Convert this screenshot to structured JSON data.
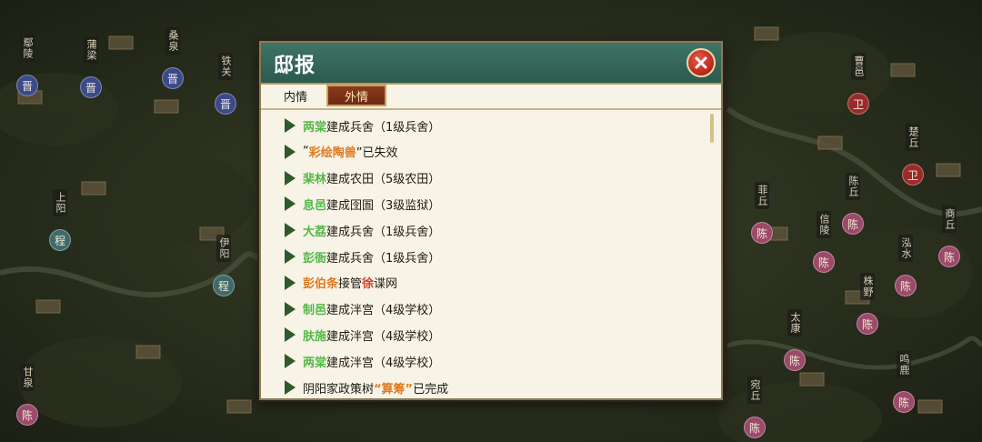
{
  "dialog": {
    "title": "邸报",
    "close_icon": "close-icon"
  },
  "tabs": [
    {
      "label": "内情",
      "active": false
    },
    {
      "label": "外情",
      "active": true
    }
  ],
  "colors": {
    "green": "#54b848",
    "orange": "#e07a22",
    "red": "#d9402a",
    "dark": "#1d1a14"
  },
  "news": [
    {
      "parts": [
        {
          "t": "两棠",
          "c": "green"
        },
        {
          "t": "建成兵舍（1级兵舍）",
          "c": "dark"
        }
      ]
    },
    {
      "parts": [
        {
          "t": "“",
          "c": "dark"
        },
        {
          "t": "彩绘陶兽",
          "c": "orange"
        },
        {
          "t": "”已失效",
          "c": "dark"
        }
      ]
    },
    {
      "parts": [
        {
          "t": "棐林",
          "c": "green"
        },
        {
          "t": "建成农田（5级农田）",
          "c": "dark"
        }
      ]
    },
    {
      "parts": [
        {
          "t": "息邑",
          "c": "green"
        },
        {
          "t": "建成囹圄（3级监狱）",
          "c": "dark"
        }
      ]
    },
    {
      "parts": [
        {
          "t": "大荔",
          "c": "green"
        },
        {
          "t": "建成兵舍（1级兵舍）",
          "c": "dark"
        }
      ]
    },
    {
      "parts": [
        {
          "t": "彭衙",
          "c": "green"
        },
        {
          "t": "建成兵舍（1级兵舍）",
          "c": "dark"
        }
      ]
    },
    {
      "parts": [
        {
          "t": "彭伯条",
          "c": "orange"
        },
        {
          "t": "接管",
          "c": "dark"
        },
        {
          "t": "徐",
          "c": "red"
        },
        {
          "t": "谍网",
          "c": "dark"
        }
      ]
    },
    {
      "parts": [
        {
          "t": "制邑",
          "c": "green"
        },
        {
          "t": "建成泮宫（4级学校）",
          "c": "dark"
        }
      ]
    },
    {
      "parts": [
        {
          "t": "肤施",
          "c": "green"
        },
        {
          "t": "建成泮宫（4级学校）",
          "c": "dark"
        }
      ]
    },
    {
      "parts": [
        {
          "t": "两棠",
          "c": "green"
        },
        {
          "t": "建成泮宫（4级学校）",
          "c": "dark"
        }
      ]
    },
    {
      "parts": [
        {
          "t": "阴阳家政策树",
          "c": "dark"
        },
        {
          "t": "“算筹”",
          "c": "orange"
        },
        {
          "t": "已完成",
          "c": "dark"
        }
      ]
    }
  ],
  "map": {
    "labels": [
      {
        "text": "鄢陵",
        "seal": "晋",
        "sealColor": "#3b4a8a"
      },
      {
        "text": "蒲梁",
        "seal": "晋",
        "sealColor": "#3b4a8a"
      },
      {
        "text": "桑泉",
        "seal": "晋",
        "sealColor": "#3b4a8a"
      },
      {
        "text": "铁关",
        "seal": "晋",
        "sealColor": "#3b4a8a"
      },
      {
        "text": "曹邑",
        "seal": "卫",
        "sealColor": "#9a2b2b"
      },
      {
        "text": "楚丘",
        "seal": "卫",
        "sealColor": "#9a2b2b"
      },
      {
        "text": "菲丘",
        "seal": "陈",
        "sealColor": "#9b4a6a"
      },
      {
        "text": "陈丘",
        "seal": "陈",
        "sealColor": "#9b4a6a"
      },
      {
        "text": "信陵",
        "seal": "陈",
        "sealColor": "#9b4a6a"
      },
      {
        "text": "株野",
        "seal": "陈",
        "sealColor": "#9b4a6a"
      },
      {
        "text": "太康",
        "seal": "陈",
        "sealColor": "#9b4a6a"
      },
      {
        "text": "商丘",
        "seal": "陈",
        "sealColor": "#9b4a6a"
      },
      {
        "text": "泓水",
        "seal": "陈",
        "sealColor": "#9b4a6a"
      },
      {
        "text": "鸣鹿",
        "seal": "陈",
        "sealColor": "#9b4a6a"
      },
      {
        "text": "宛丘",
        "seal": "陈",
        "sealColor": "#9b4a6a"
      },
      {
        "text": "上阳",
        "seal": "程",
        "sealColor": "#3e6a6a"
      },
      {
        "text": "伊阳",
        "seal": "程",
        "sealColor": "#3e6a6a"
      },
      {
        "text": "甘泉",
        "seal": "陈",
        "sealColor": "#9b4a6a"
      }
    ]
  }
}
